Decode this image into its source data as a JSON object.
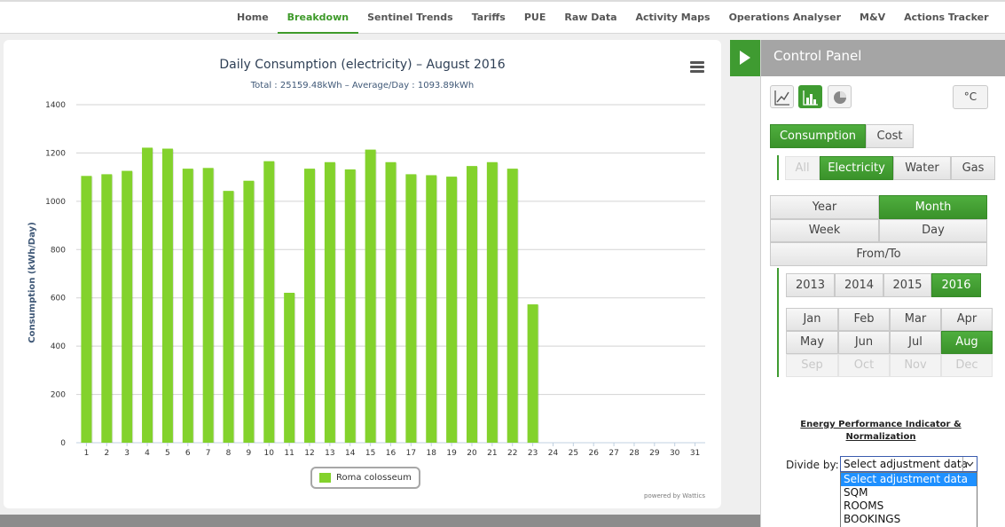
{
  "nav": {
    "items": [
      "Home",
      "Breakdown",
      "Sentinel Trends",
      "Tariffs",
      "PUE",
      "Raw Data",
      "Activity Maps",
      "Operations Analyser",
      "M&V",
      "Actions Tracker"
    ],
    "active_index": 1
  },
  "chart": {
    "powered_by": "powered by Wattics"
  },
  "chart_data": {
    "type": "bar",
    "title": "Daily Consumption (electricity) – August 2016",
    "subtitle": "Total : 25159.48kWh – Average/Day : 1093.89kWh",
    "xlabel": "",
    "ylabel": "Consumption (kWh/Day)",
    "ylim": [
      0,
      1400
    ],
    "yticks": [
      0,
      200,
      400,
      600,
      800,
      1000,
      1200,
      1400
    ],
    "grid": true,
    "legend_position": "bottom-center",
    "categories": [
      "1",
      "2",
      "3",
      "4",
      "5",
      "6",
      "7",
      "8",
      "9",
      "10",
      "11",
      "12",
      "13",
      "14",
      "15",
      "16",
      "17",
      "18",
      "19",
      "20",
      "21",
      "22",
      "23",
      "24",
      "25",
      "26",
      "27",
      "28",
      "29",
      "30",
      "31"
    ],
    "series": [
      {
        "name": "Roma colosseum",
        "color": "#83d22c",
        "values": [
          1105,
          1112,
          1126,
          1222,
          1218,
          1135,
          1138,
          1043,
          1085,
          1166,
          621,
          1135,
          1162,
          1132,
          1214,
          1162,
          1112,
          1108,
          1102,
          1146,
          1162,
          1135,
          573,
          null,
          null,
          null,
          null,
          null,
          null,
          null,
          null
        ]
      }
    ]
  },
  "control_panel": {
    "title": "Control Panel",
    "unit_button": "°C",
    "chart_type_icons": [
      "line-chart-icon",
      "bar-chart-icon",
      "pie-chart-icon"
    ],
    "measure_tabs": [
      "Consumption",
      "Cost"
    ],
    "utility_tabs": [
      "All",
      "Electricity",
      "Water",
      "Gas"
    ],
    "period_buttons": {
      "year": "Year",
      "month": "Month",
      "week": "Week",
      "day": "Day",
      "from_to": "From/To"
    },
    "years": [
      "2013",
      "2014",
      "2015",
      "2016"
    ],
    "months": [
      "Jan",
      "Feb",
      "Mar",
      "Apr",
      "May",
      "Jun",
      "Jul",
      "Aug",
      "Sep",
      "Oct",
      "Nov",
      "Dec"
    ],
    "epi_title_1": "Energy Performance Indicator &",
    "epi_title_2": "Normalization",
    "divide_label": "Divide by:",
    "select_value": "Select adjustment data",
    "dropdown_options": [
      "Select adjustment data",
      "SQM",
      "ROOMS",
      "BOOKINGS"
    ]
  }
}
